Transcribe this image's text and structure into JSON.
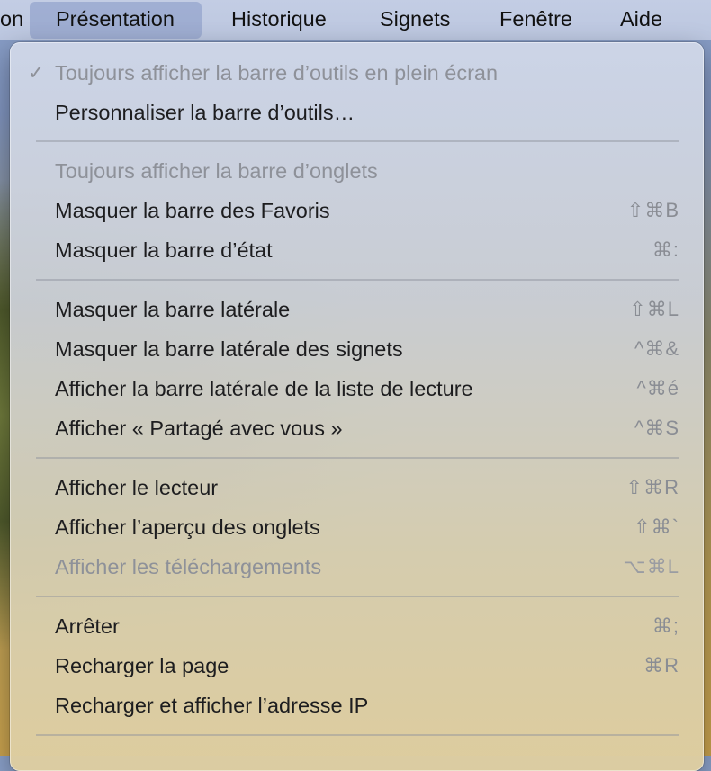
{
  "menubar": {
    "items": [
      {
        "label": "on"
      },
      {
        "label": "Présentation"
      },
      {
        "label": "Historique"
      },
      {
        "label": "Signets"
      },
      {
        "label": "Fenêtre"
      },
      {
        "label": "Aide"
      }
    ]
  },
  "menu": {
    "items": [
      {
        "label": "Toujours afficher la barre d’outils en plein écran",
        "checkmark": "✓",
        "shortcut": ""
      },
      {
        "label": "Personnaliser la barre d’outils…",
        "shortcut": ""
      },
      {
        "label": "Toujours afficher la barre d’onglets",
        "shortcut": ""
      },
      {
        "label": "Masquer la barre des Favoris",
        "shortcut": "⇧⌘B"
      },
      {
        "label": "Masquer la barre d’état",
        "shortcut": "⌘:"
      },
      {
        "label": "Masquer la barre latérale",
        "shortcut": "⇧⌘L"
      },
      {
        "label": "Masquer la barre latérale des signets",
        "shortcut": "^⌘&"
      },
      {
        "label": "Afficher la barre latérale de la liste de lecture",
        "shortcut": "^⌘é"
      },
      {
        "label": "Afficher « Partagé avec vous »",
        "shortcut": "^⌘S"
      },
      {
        "label": "Afficher le lecteur",
        "shortcut": "⇧⌘R"
      },
      {
        "label": "Afficher l’aperçu des onglets",
        "shortcut": "⇧⌘`"
      },
      {
        "label": "Afficher les téléchargements",
        "shortcut": "⌥⌘L"
      },
      {
        "label": "Arrêter",
        "shortcut": "⌘;"
      },
      {
        "label": "Recharger la page",
        "shortcut": "⌘R"
      },
      {
        "label": "Recharger et afficher l’adresse IP",
        "shortcut": ""
      }
    ]
  }
}
